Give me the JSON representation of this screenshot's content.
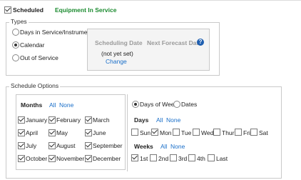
{
  "header": {
    "scheduled_label": "Scheduled",
    "status_text": "Equipment In Service"
  },
  "types": {
    "legend": "Types",
    "options": [
      "Days in Service/Instrument",
      "Calendar",
      "Out of Service"
    ],
    "selected": "Calendar",
    "scheduling_date_label": "Scheduling Date",
    "next_forecast_label": "Next Forecast Date",
    "not_set_text": "(not yet set)",
    "change_link": "Change"
  },
  "schedule_options": {
    "legend": "Schedule Options",
    "months_label": "Months",
    "all_link": "All",
    "none_link": "None",
    "months": [
      {
        "label": "January",
        "checked": true
      },
      {
        "label": "February",
        "checked": true
      },
      {
        "label": "March",
        "checked": true
      },
      {
        "label": "April",
        "checked": true
      },
      {
        "label": "May",
        "checked": true
      },
      {
        "label": "June",
        "checked": true
      },
      {
        "label": "July",
        "checked": true
      },
      {
        "label": "August",
        "checked": true
      },
      {
        "label": "September",
        "checked": true
      },
      {
        "label": "October",
        "checked": true
      },
      {
        "label": "November",
        "checked": true
      },
      {
        "label": "December",
        "checked": true
      }
    ],
    "mode_options": [
      "Days of Week",
      "Dates"
    ],
    "mode_selected": "Days of Week",
    "days_label": "Days",
    "days": [
      {
        "label": "Sun",
        "checked": false
      },
      {
        "label": "Mon",
        "checked": true
      },
      {
        "label": "Tue",
        "checked": false
      },
      {
        "label": "Wed",
        "checked": false
      },
      {
        "label": "Thur",
        "checked": false
      },
      {
        "label": "Fri",
        "checked": false
      },
      {
        "label": "Sat",
        "checked": false
      }
    ],
    "weeks_label": "Weeks",
    "weeks": [
      {
        "label": "1st",
        "checked": true
      },
      {
        "label": "2nd",
        "checked": false
      },
      {
        "label": "3rd",
        "checked": false
      },
      {
        "label": "4th",
        "checked": false
      },
      {
        "label": "Last",
        "checked": false
      }
    ]
  },
  "colors": {
    "accent_green": "#1a8a2e",
    "link_blue": "#1a6fc9",
    "help_icon_blue": "#1f5fb0"
  }
}
